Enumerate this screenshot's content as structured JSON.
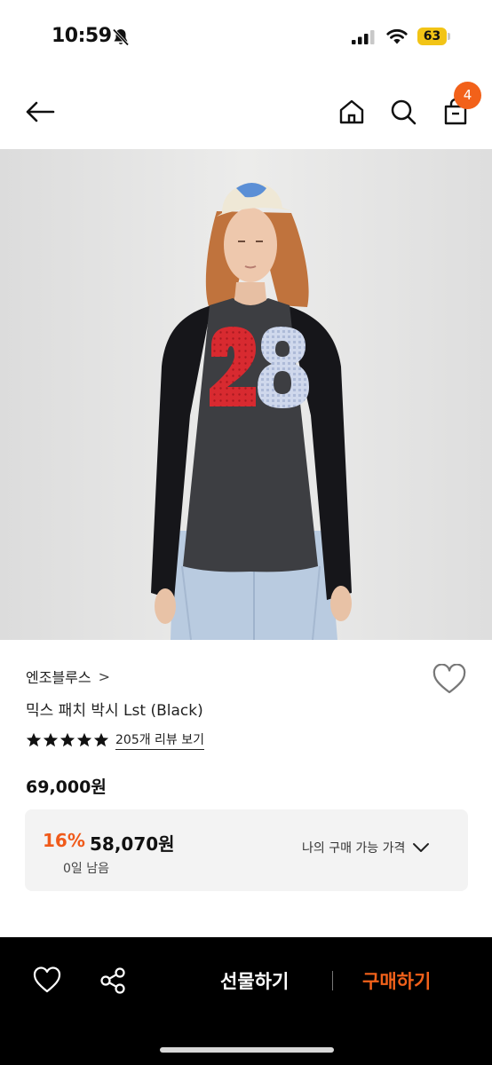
{
  "status_bar": {
    "time": "10:59",
    "battery": "63"
  },
  "nav": {
    "cart_count": "4",
    "icons": [
      "back-arrow-icon",
      "home-icon",
      "search-icon",
      "shopping-bag-icon"
    ]
  },
  "product": {
    "brand": "엔조블루스",
    "brand_chevron": ">",
    "name": "믹스 패치 박시 Lst (Black)",
    "rating_stars": 5,
    "review_link": "205개 리뷰 보기",
    "original_price": "69,000원",
    "shirt_number": "28"
  },
  "deal": {
    "discount_percent": "16%",
    "sale_price": "58,070원",
    "time_left": "0일 남음",
    "my_price_label": "나의 구매 가능 가격"
  },
  "bottom_bar": {
    "gift_label": "선물하기",
    "buy_label": "구매하기"
  },
  "colors": {
    "accent": "#f2611a",
    "discount": "#f05a1a",
    "battery": "#f2c416",
    "deal_bg": "#f3f3f3"
  }
}
